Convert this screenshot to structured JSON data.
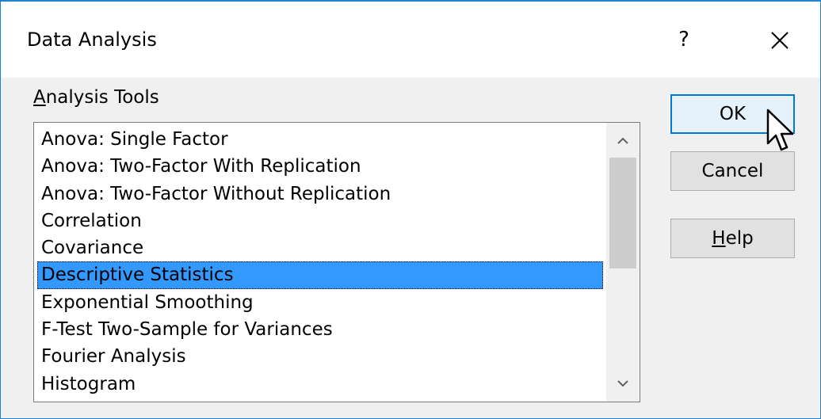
{
  "dialog": {
    "title": "Data Analysis",
    "help_glyph": "?",
    "close_glyph": "close"
  },
  "analysis_tools": {
    "label_mnemonic": "A",
    "label_rest": "nalysis Tools",
    "items": [
      {
        "label": "Anova: Single Factor",
        "selected": false
      },
      {
        "label": "Anova: Two-Factor With Replication",
        "selected": false
      },
      {
        "label": "Anova: Two-Factor Without Replication",
        "selected": false
      },
      {
        "label": "Correlation",
        "selected": false
      },
      {
        "label": "Covariance",
        "selected": false
      },
      {
        "label": "Descriptive Statistics",
        "selected": true
      },
      {
        "label": "Exponential Smoothing",
        "selected": false
      },
      {
        "label": "F-Test Two-Sample for Variances",
        "selected": false
      },
      {
        "label": "Fourier Analysis",
        "selected": false
      },
      {
        "label": "Histogram",
        "selected": false
      }
    ],
    "scroll_position": 0.0
  },
  "buttons": {
    "ok_label": "OK",
    "cancel_label": "Cancel",
    "help_mnemonic": "H",
    "help_rest": "elp"
  },
  "colors": {
    "selection": "#3399ff",
    "default_button_border": "#0078d7",
    "window_border": "#1e81d3"
  }
}
